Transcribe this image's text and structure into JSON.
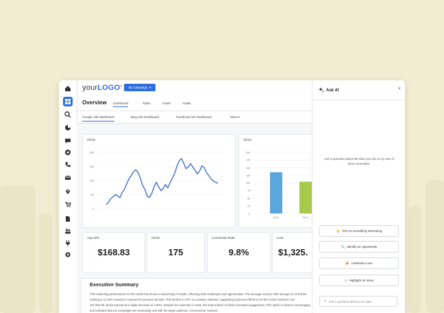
{
  "app": {
    "logo_text": "your",
    "logo_brand": "LOGO",
    "campaign_button": "My Campaign",
    "page_title": "Overview",
    "main_tabs": [
      "Dashboard",
      "Tasks",
      "Goals",
      "Audits"
    ],
    "sub_tabs": [
      "Google Ads Dashboard",
      "Bing Ads Dashboard",
      "Facebook Ads Dashboard",
      "More"
    ]
  },
  "sidebar_icons": [
    "home-icon",
    "dashboard-icon",
    "search-icon",
    "analytics-icon",
    "chat-icon",
    "link-icon",
    "phone-icon",
    "mail-icon",
    "location-icon",
    "cart-icon",
    "document-icon",
    "people-icon",
    "plug-icon",
    "settings-icon"
  ],
  "kpis": [
    {
      "label": "Avg CPC",
      "value": "$168.83"
    },
    {
      "label": "Clicks",
      "value": "175"
    },
    {
      "label": "Conversion Rate",
      "value": "9.8%"
    },
    {
      "label": "Cost",
      "value": "$1,325."
    }
  ],
  "executive_summary": {
    "title": "Executive Summary",
    "text": "This marketing performance for the month has shown a mixed bag of results, reflecting both challenges and opportunities. The average cost per click average of CAD $.98, marking a 21.50% reduction compared to previous periods. This decline in CPC is a positive indicator, suggesting improved efficiency for the month reached CAD 157,302.09, which represents a slight decrease of 4.53%. Despite the reduction in costs, the total number of clicks increased engagement. This uptick in clicks is encouraging and indicates that our campaigns are resonating well with the target audience. Conversions, however"
  },
  "ask_ai": {
    "title": "Ask AI",
    "close": "×",
    "prompt": "Ask a question about the data you see or try one of these examples:",
    "suggestions": [
      "Tell me something interesting",
      "Identify an opportunity",
      "Celebrate a win",
      "Highlight an issue"
    ],
    "input_placeholder": "Ask a question about your data"
  },
  "chart_data": [
    {
      "type": "line",
      "title": "Clicks",
      "ylim": [
        0,
        200
      ],
      "y_ticks": [
        0,
        50,
        100,
        150,
        200
      ],
      "x": [
        1,
        2,
        3,
        4,
        5,
        6,
        7,
        8,
        9,
        10,
        11,
        12,
        13,
        14,
        15,
        16,
        17,
        18,
        19,
        20,
        21,
        22,
        23,
        24,
        25,
        26,
        27,
        28,
        29,
        30,
        31,
        32,
        33,
        34,
        35,
        36,
        37,
        38,
        39,
        40,
        41,
        42,
        43,
        44,
        45,
        46,
        47,
        48,
        49,
        50
      ],
      "series": [
        {
          "values": [
            15,
            22,
            36,
            42,
            50,
            46,
            39,
            58,
            68,
            88,
            106,
            118,
            132,
            138,
            128,
            108,
            82,
            68,
            44,
            40,
            54,
            78,
            94,
            78,
            64,
            72,
            86,
            74,
            92,
            108,
            125,
            150,
            170,
            178,
            162,
            142,
            148,
            160,
            148,
            136,
            124,
            134,
            152,
            146,
            128,
            118,
            106,
            98,
            94,
            90
          ]
        }
      ],
      "color": "#3f6ec0"
    },
    {
      "type": "bar",
      "title": "Clicks",
      "ylim": [
        0,
        200
      ],
      "y_ticks": [
        0,
        25,
        50,
        75,
        100,
        125,
        150,
        175,
        200
      ],
      "categories": [
        "Ad 1",
        "Ad 2"
      ],
      "values": [
        135,
        104
      ],
      "colors": [
        "#5ba7dd",
        "#a9c94a"
      ]
    }
  ]
}
